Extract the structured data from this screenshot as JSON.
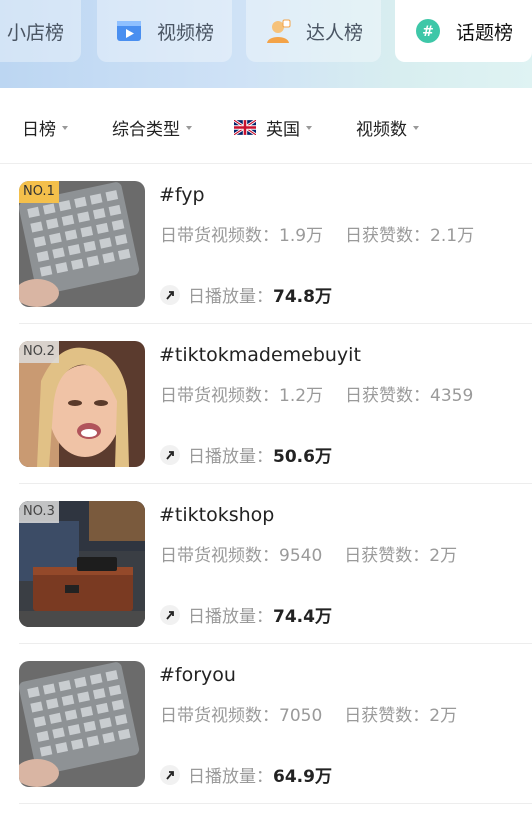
{
  "tabs": [
    {
      "label": "小店榜",
      "icon": "shop-icon",
      "active": false
    },
    {
      "label": "视频榜",
      "icon": "video-clip-icon",
      "active": false
    },
    {
      "label": "达人榜",
      "icon": "creator-icon",
      "active": false
    },
    {
      "label": "话题榜",
      "icon": "topic-icon",
      "active": true
    }
  ],
  "filters": {
    "period": "日榜",
    "category": "综合类型",
    "country": "英国",
    "sort": "视频数"
  },
  "items": [
    {
      "rank": "NO.1",
      "title": "#fyp",
      "video_label": "日带货视频数：",
      "video_count": "1.9万",
      "likes_label": "日获赞数：",
      "likes": "2.1万",
      "plays_label": "日播放量：",
      "plays": "74.8万"
    },
    {
      "rank": "NO.2",
      "title": "#tiktokmademebuyit",
      "video_label": "日带货视频数：",
      "video_count": "1.2万",
      "likes_label": "日获赞数：",
      "likes": "4359",
      "plays_label": "日播放量：",
      "plays": "50.6万"
    },
    {
      "rank": "NO.3",
      "title": "#tiktokshop",
      "video_label": "日带货视频数：",
      "video_count": "9540",
      "likes_label": "日获赞数：",
      "likes": "2万",
      "plays_label": "日播放量：",
      "plays": "74.4万"
    },
    {
      "rank": "",
      "title": "#foryou",
      "video_label": "日带货视频数：",
      "video_count": "7050",
      "likes_label": "日获赞数：",
      "likes": "2万",
      "plays_label": "日播放量：",
      "plays": "64.9万"
    }
  ]
}
